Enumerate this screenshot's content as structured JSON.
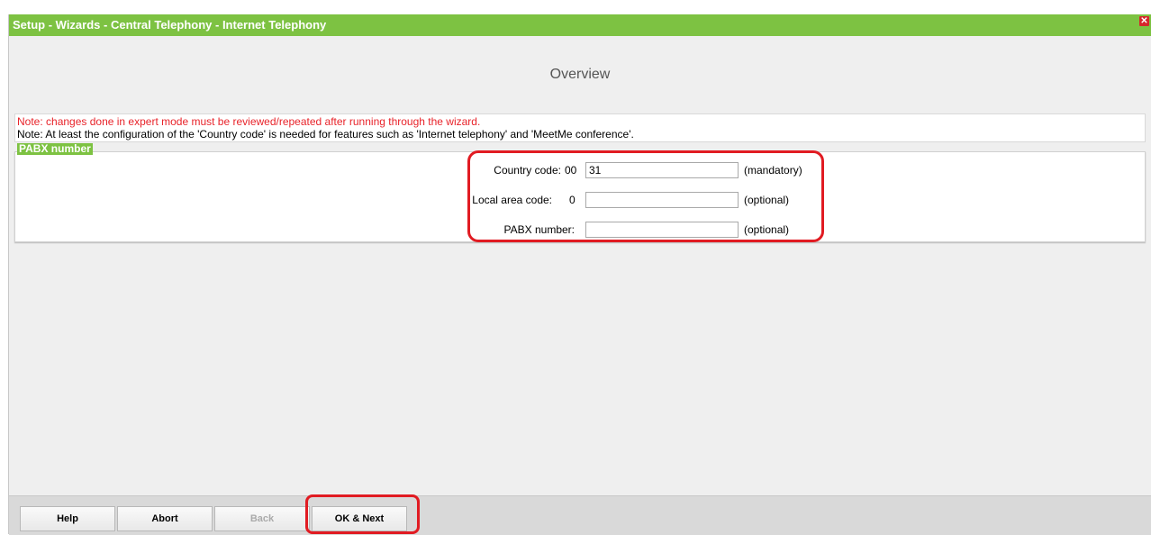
{
  "window": {
    "title": "Setup - Wizards - Central Telephony - Internet Telephony",
    "close_icon": "close-icon"
  },
  "overview": {
    "heading": "Overview"
  },
  "notes": {
    "warning": "Note: changes done in expert mode must be reviewed/repeated after running through the wizard.",
    "info": "Note: At least the configuration of the 'Country code' is needed for features such as 'Internet telephony' and 'MeetMe conference'."
  },
  "pabx": {
    "legend": "PABX number",
    "country_code": {
      "label": "Country code:",
      "prefix": "00",
      "value": "31",
      "hint": "(mandatory)"
    },
    "local_area_code": {
      "label": "Local area code:",
      "prefix": "0",
      "value": "",
      "hint": "(optional)"
    },
    "pabx_number": {
      "label": "PABX number:",
      "prefix": "",
      "value": "",
      "hint": "(optional)"
    }
  },
  "buttons": {
    "help": "Help",
    "abort": "Abort",
    "back": "Back",
    "ok_next": "OK & Next"
  },
  "colors": {
    "accent_green": "#7dc242",
    "warning_red": "#e8232a",
    "highlight_red": "#e11b22"
  }
}
